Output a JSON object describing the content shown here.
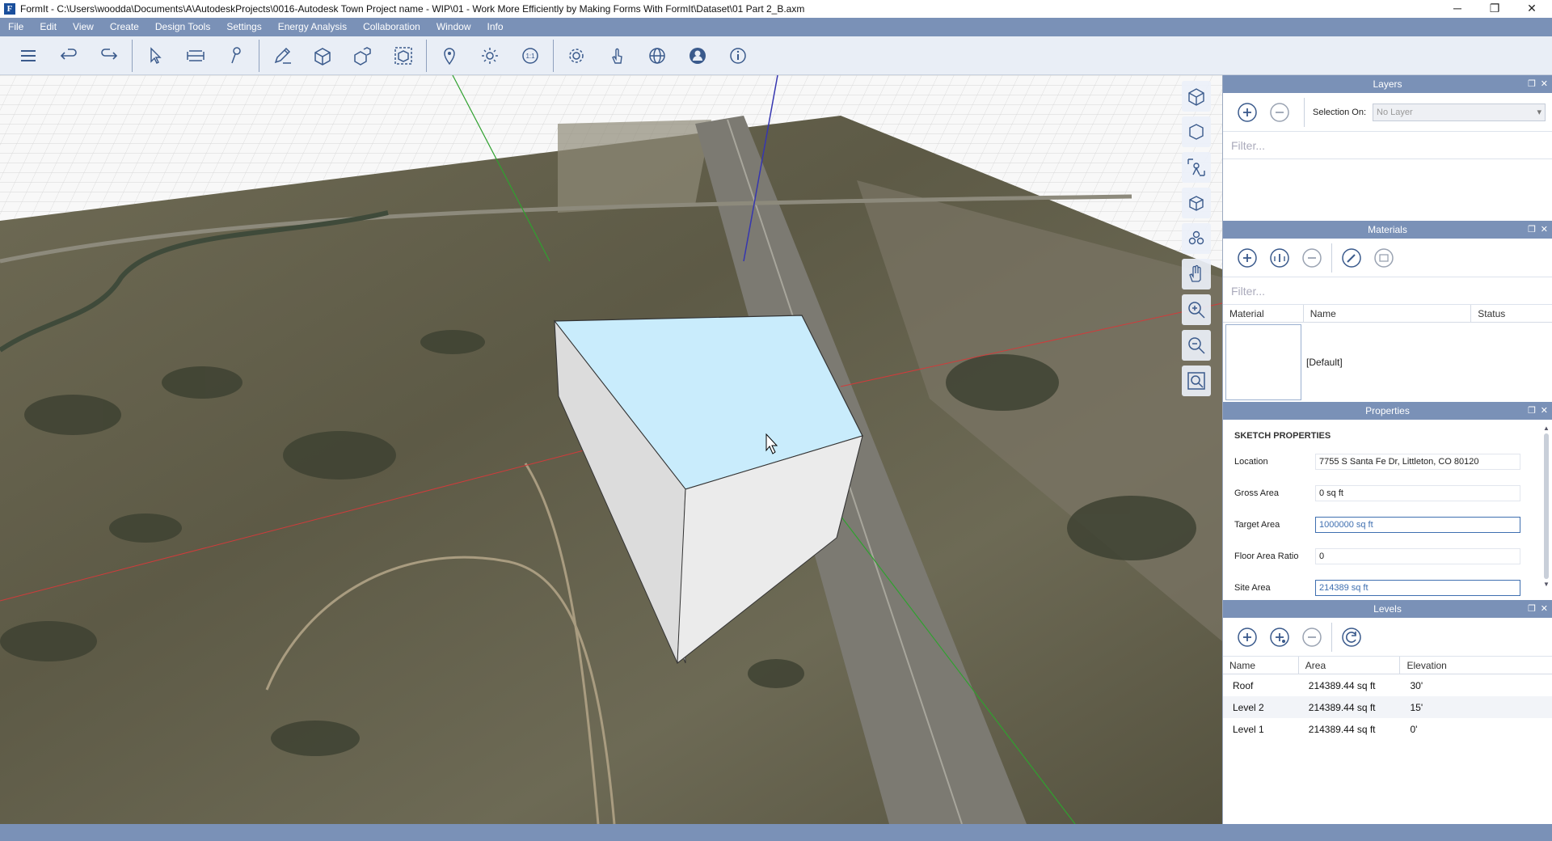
{
  "window": {
    "title": "FormIt - C:\\Users\\woodda\\Documents\\A\\AutodeskProjects\\0016-Autodesk Town Project name - WIP\\01 - Work More Efficiently by Making Forms With FormIt\\Dataset\\01 Part 2_B.axm",
    "app_icon": "F",
    "minimize": "─",
    "maximize": "❐",
    "close": "✕"
  },
  "menu": [
    "File",
    "Edit",
    "View",
    "Create",
    "Design Tools",
    "Settings",
    "Energy Analysis",
    "Collaboration",
    "Window",
    "Info"
  ],
  "toolbar": {
    "groups": [
      [
        "menu-icon",
        "undo-icon",
        "redo-icon"
      ],
      [
        "select-icon",
        "tape-measure-icon",
        "paint-icon"
      ],
      [
        "sketch-pencil-icon",
        "solid-box-icon",
        "solid-tools-icon",
        "group-icon"
      ],
      [
        "location-pin-icon",
        "sun-icon",
        "scale-icon"
      ],
      [
        "settings-gear-icon",
        "touch-icon",
        "globe-icon",
        "user-profile-icon",
        "info-icon"
      ]
    ]
  },
  "viewtools": [
    "perspective-cube-icon",
    "orthographic-cube-icon",
    "look-around-icon",
    "orbit-cube-icon",
    "orbit-icon",
    "pan-hand-icon",
    "zoom-in-icon",
    "zoom-out-icon",
    "zoom-extents-icon"
  ],
  "layers": {
    "title": "Layers",
    "selection_on_label": "Selection On:",
    "selection_on_value": "No Layer",
    "filter_placeholder": "Filter..."
  },
  "materials": {
    "title": "Materials",
    "filter_placeholder": "Filter...",
    "columns": [
      "Material",
      "Name",
      "Status"
    ],
    "rows": [
      {
        "name": "[Default]",
        "status": ""
      }
    ]
  },
  "properties": {
    "title": "Properties",
    "section": "SKETCH PROPERTIES",
    "rows": [
      {
        "label": "Location",
        "value": "7755 S Santa Fe Dr, Littleton, CO 80120",
        "editable": false
      },
      {
        "label": "Gross Area",
        "value": "0 sq ft",
        "editable": false
      },
      {
        "label": "Target Area",
        "value": "1000000 sq ft",
        "editable": true
      },
      {
        "label": "Floor Area Ratio",
        "value": "0",
        "editable": false
      },
      {
        "label": "Site Area",
        "value": "214389 sq ft",
        "editable": true
      }
    ]
  },
  "levels": {
    "title": "Levels",
    "columns": [
      "Name",
      "Area",
      "Elevation"
    ],
    "rows": [
      {
        "name": "Roof",
        "area": "214389.44 sq ft",
        "elevation": "30'"
      },
      {
        "name": "Level 2",
        "area": "214389.44 sq ft",
        "elevation": "15'"
      },
      {
        "name": "Level 1",
        "area": "214389.44 sq ft",
        "elevation": "0'"
      }
    ]
  },
  "colors": {
    "chrome": "#7a91b7",
    "roof_selected": "#c9ecfc",
    "axis_green": "#2fa12f",
    "axis_red": "#d13b3b",
    "axis_blue": "#3636b0"
  }
}
